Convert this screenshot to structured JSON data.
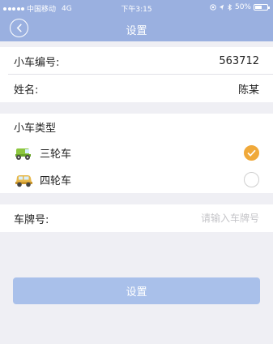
{
  "status_bar": {
    "carrier": "中国移动",
    "network": "4G",
    "time": "下午3:15",
    "battery": "50%",
    "battery_level": 0.5
  },
  "nav": {
    "back_icon": "chevron-left-icon",
    "title": "设置"
  },
  "info": {
    "number_label": "小车编号:",
    "number_value": "563712",
    "name_label": "姓名:",
    "name_value": "陈某"
  },
  "cart_type": {
    "header": "小车类型",
    "options": [
      {
        "label": "三轮车",
        "icon": "tricycle-icon",
        "selected": true
      },
      {
        "label": "四轮车",
        "icon": "four-wheeler-icon",
        "selected": false
      }
    ]
  },
  "plate": {
    "label": "车牌号:",
    "value": "",
    "placeholder": "请输入车牌号"
  },
  "submit_label": "设置",
  "colors": {
    "header_bg": "#9ab0e0",
    "button_bg": "#a9c0ea",
    "radio_checked": "#f0a93a"
  }
}
